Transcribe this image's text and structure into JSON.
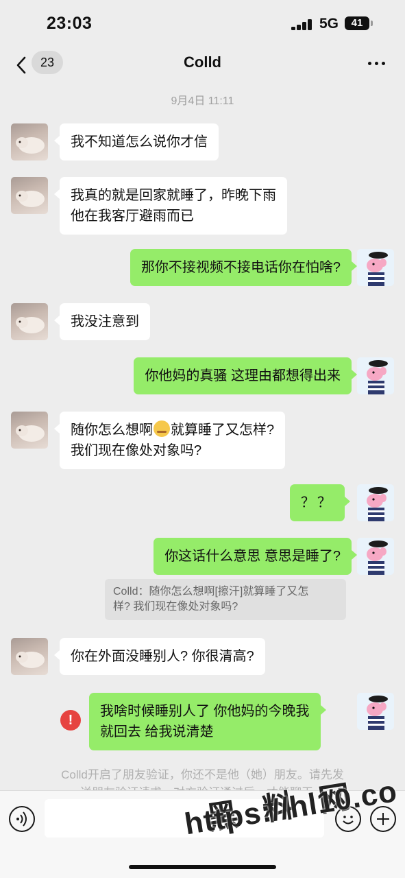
{
  "status_bar": {
    "time": "23:03",
    "network": "5G",
    "battery": "41"
  },
  "nav": {
    "unread_count": "23",
    "title": "Colld"
  },
  "chat": {
    "timestamp": "9月4日 11:11",
    "messages": [
      {
        "lines": [
          "我不知道怎么说你才信"
        ]
      },
      {
        "lines": [
          "我真的就是回家就睡了，昨晚下雨",
          "他在我客厅避雨而已"
        ]
      },
      {
        "lines": [
          "那你不接视频不接电话你在怕啥?"
        ]
      },
      {
        "lines": [
          "我没注意到"
        ]
      },
      {
        "lines": [
          "你他妈的真骚 这理由都想得出来"
        ]
      },
      {
        "lines_before_emoji": "随你怎么想啊",
        "lines_after_emoji": "就算睡了又怎样?",
        "line2": "我们现在像处对象吗?"
      },
      {
        "lines": [
          "？？"
        ]
      },
      {
        "lines": [
          "你这话什么意思 意思是睡了?"
        ]
      },
      {
        "lines": [
          "你在外面没睡别人? 你很清高?"
        ]
      },
      {
        "lines": [
          "我啥时候睡别人了 你他妈的今晚我",
          "就回去 给我说清楚"
        ]
      }
    ],
    "quote": [
      "Colld：随你怎么想啊[擦汗]就算睡了又怎",
      "样? 我们现在像处对象吗?"
    ],
    "system_notice": [
      "Colld开启了朋友验证，你还不是他（她）朋友。请先发",
      "送朋友验证请求，对方验证通过后，才能聊天。"
    ],
    "send_failed_mark": "!"
  },
  "watermark": {
    "cn": "黑 料 网",
    "url": "https://hl10.co"
  },
  "icons": {
    "back": "chevron-left-icon",
    "more": "more-dots-icon",
    "voice": "voice-icon",
    "emoji": "emoji-icon",
    "plus": "plus-icon",
    "error": "error-icon"
  },
  "colors": {
    "bubble_out": "#95ec69",
    "bubble_in": "#ffffff",
    "background": "#ededed",
    "error": "#e64340"
  }
}
